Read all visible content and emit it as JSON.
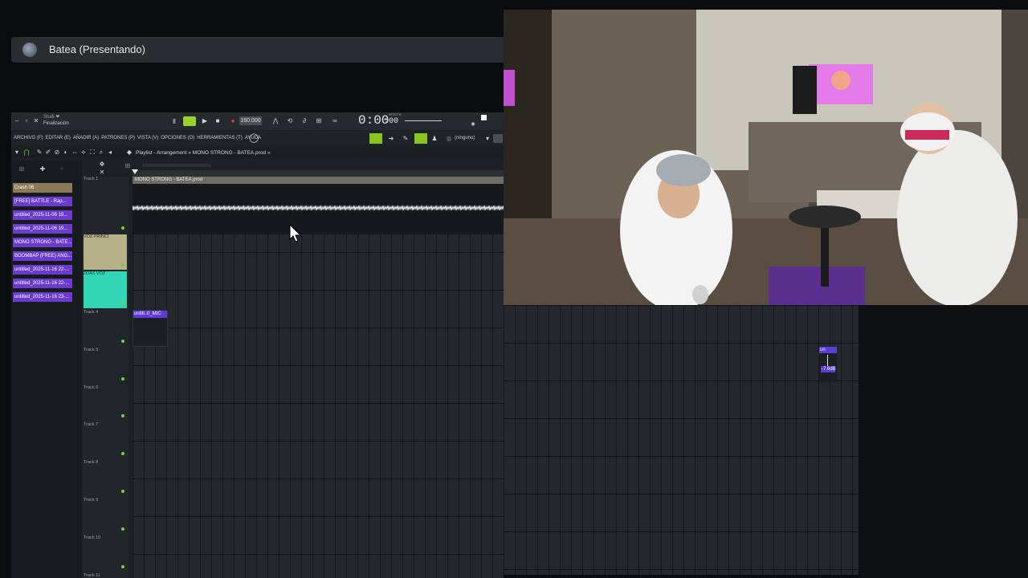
{
  "presenter": {
    "name": "Batea (Presentando)"
  },
  "daw": {
    "hint": {
      "line1": "Studi ❤",
      "line2": "Finalización"
    },
    "tempo": "160.000",
    "time": "0:00",
    "time_frac": ":00",
    "time_unit": "M:S:CS",
    "menu": [
      "ARCHIVO (F)",
      "EDITAR (E)",
      "AÑADIR (A)",
      "PATRONES (P)",
      "VISTA (V)",
      "OPCIONES (O)",
      "HERRAMIENTAS (T)",
      "AYUDA"
    ],
    "output": "(ninguno)",
    "playlist_title": "Playlist - Arrangement » MONO STRONG - BATEA.prod »",
    "browser_items": [
      {
        "label": "Crash 06",
        "color": "#8b7a5a"
      },
      {
        "label": "[FREE] BATTLE - Rap...",
        "color": "#6b3bd0"
      },
      {
        "label": "untitled_2025-11-06 19...",
        "color": "#6b3bd0"
      },
      {
        "label": "untitled_2025-11-06 19...",
        "color": "#6b3bd0"
      },
      {
        "label": "MONO STRONG - BATE...",
        "color": "#6b3bd0"
      },
      {
        "label": "BOOMBAP (FREE) ANG...",
        "color": "#6b3bd0"
      },
      {
        "label": "untitled_2025-11-16 22-...",
        "color": "#6b3bd0"
      },
      {
        "label": "untitled_2025-11-16 22-...",
        "color": "#6b3bd0"
      },
      {
        "label": "untitled_2025-11-16 23-...",
        "color": "#6b3bd0"
      }
    ],
    "tracks": [
      {
        "label": "Track 1"
      },
      {
        "label": "VOZ PRINCI"
      },
      {
        "label": "2DAS VOZ"
      },
      {
        "label": "Track 4"
      },
      {
        "label": "Track 5"
      },
      {
        "label": "Track 6"
      },
      {
        "label": "Track 7"
      },
      {
        "label": "Track 8"
      },
      {
        "label": "Track 9"
      },
      {
        "label": "Track 10"
      },
      {
        "label": "Track 11"
      }
    ],
    "clips": {
      "audio": "MONO STRONG - BATEA.prod",
      "small": "untitl..0_MIC",
      "right_label": "un",
      "right_db": "-7.6dB"
    }
  },
  "colors": {
    "accent_green": "#7ed321",
    "browser_purple": "#6b3bd0",
    "voz_princi": "#b6b089",
    "dos_voz": "#33d6b4"
  }
}
